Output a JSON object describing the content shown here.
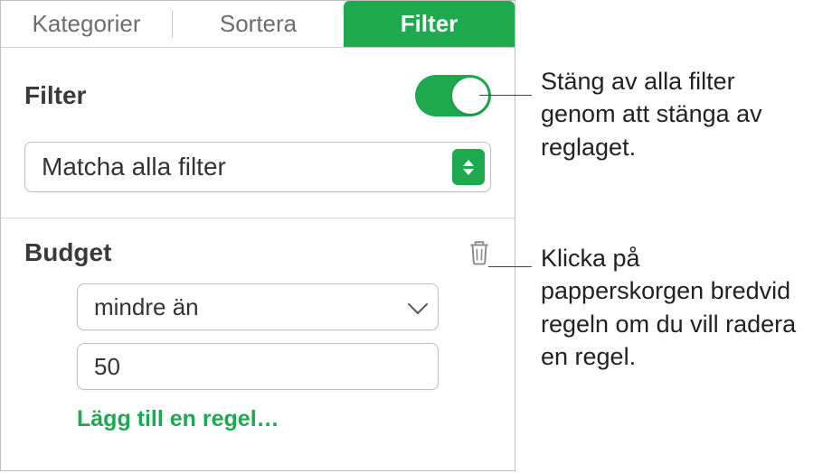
{
  "tabs": {
    "categories": "Kategorier",
    "sort": "Sortera",
    "filter": "Filter"
  },
  "filter_section": {
    "label": "Filter",
    "match_select": "Matcha alla filter"
  },
  "rule": {
    "title": "Budget",
    "operator": "mindre än",
    "value": "50",
    "add_rule": "Lägg till en regel…"
  },
  "callouts": {
    "toggle": "Stäng av alla filter genom att stänga av reglaget.",
    "trash": "Klicka på papperskorgen bredvid regeln om du vill radera en regel."
  }
}
